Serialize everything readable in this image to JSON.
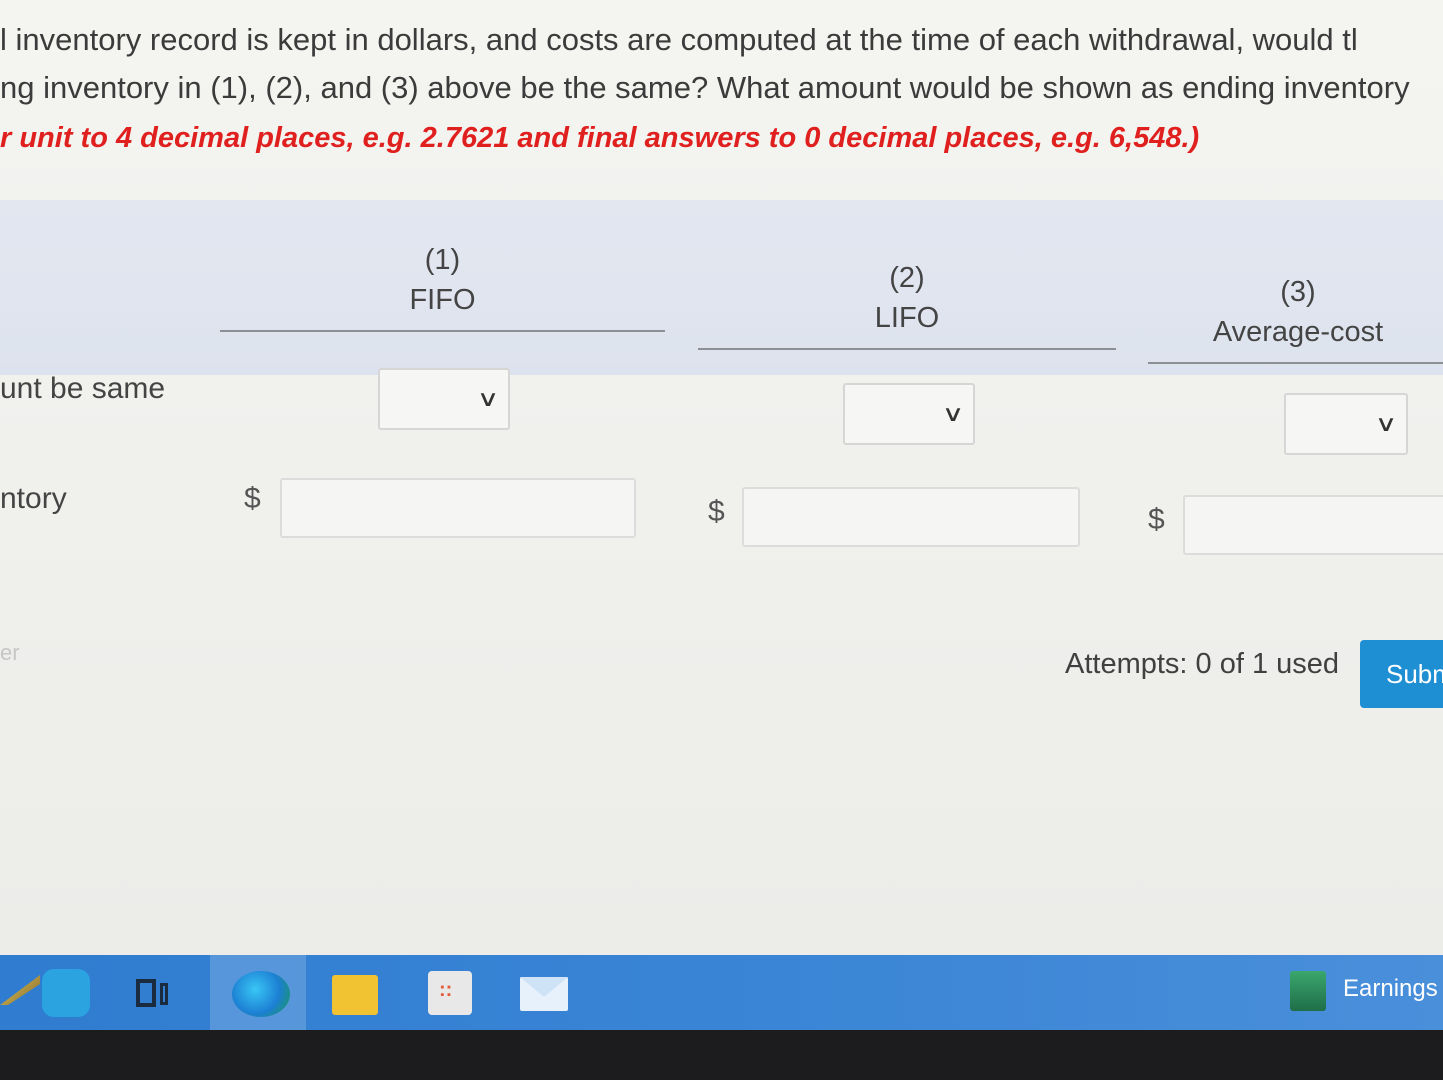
{
  "question": {
    "line1": "l inventory record is kept in dollars, and costs are computed at the time of each withdrawal, would tl",
    "line2": "ng inventory in (1), (2), and (3) above be the same? What amount would be shown as ending inventory",
    "line3": "r unit to 4 decimal places, e.g. 2.7621 and final answers to 0 decimal places, e.g. 6,548.)"
  },
  "table": {
    "columns": [
      {
        "number": "(1)",
        "name": "FIFO"
      },
      {
        "number": "(2)",
        "name": "LIFO"
      },
      {
        "number": "(3)",
        "name": "Average-cost"
      }
    ],
    "rows": {
      "same_label": "unt be same",
      "inventory_label": "ntory",
      "currency_symbol": "$"
    }
  },
  "footer": {
    "faded_label": "er",
    "attempts": "Attempts: 0 of 1 used",
    "submit_label": "Subm"
  },
  "taskbar": {
    "icons": [
      "pencil-icon",
      "search-icon",
      "task-view-icon",
      "edge-icon",
      "file-explorer-icon",
      "store-icon",
      "mail-icon"
    ],
    "widget_label": "Earnings"
  },
  "colors": {
    "instruction_red": "#e0201e",
    "submit_blue": "#1f8fd4",
    "taskbar_blue": "#3c86d6"
  }
}
